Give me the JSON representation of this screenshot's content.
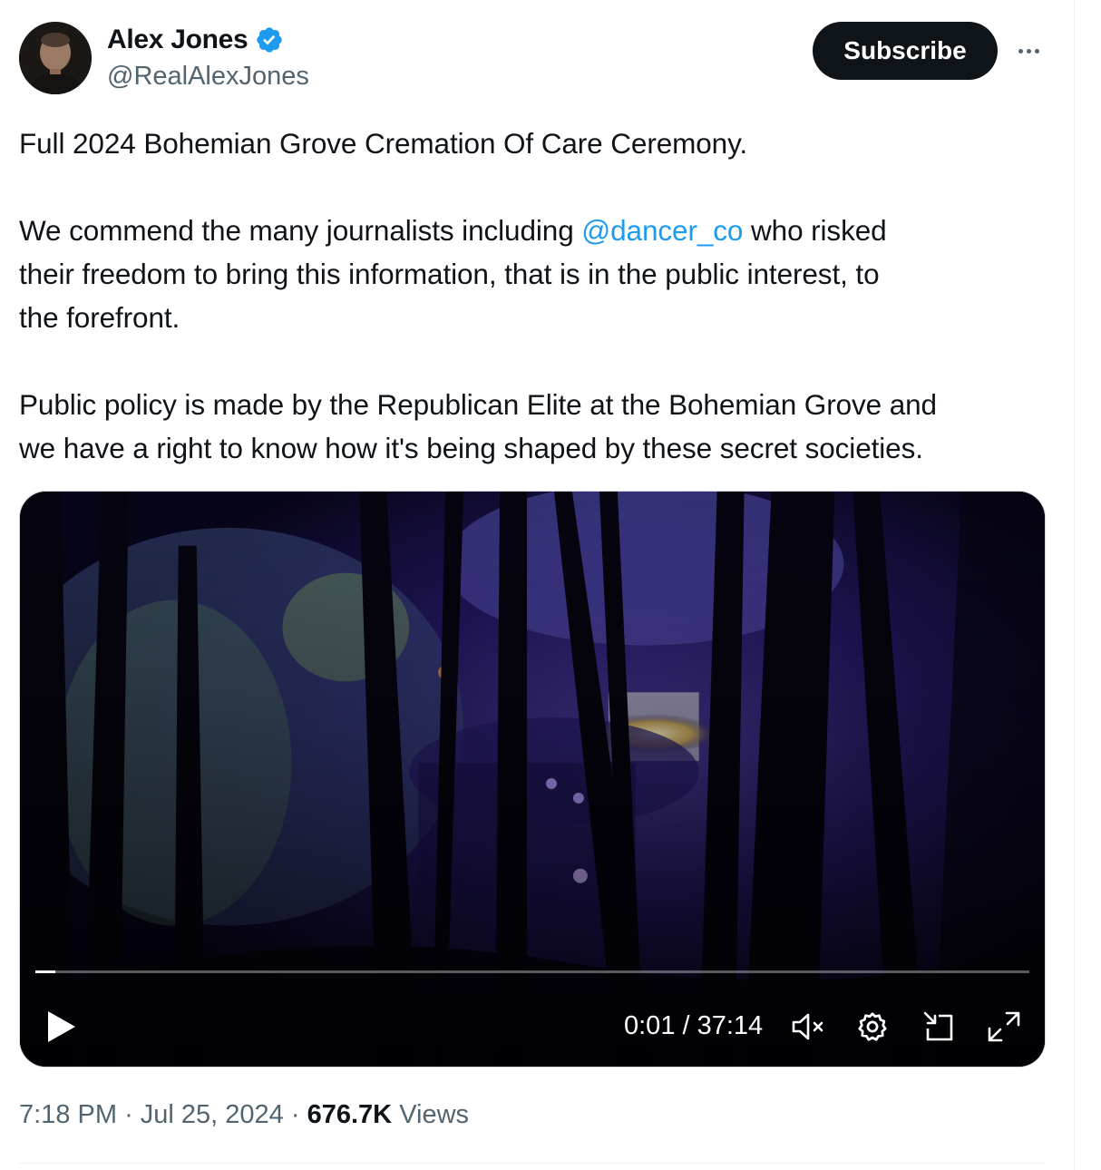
{
  "author": {
    "name": "Alex Jones",
    "handle": "@RealAlexJones",
    "verified": true,
    "verified_color": "#1d9bf0"
  },
  "actions": {
    "subscribe_label": "Subscribe",
    "more_icon": "more-horizontal-icon"
  },
  "tweet": {
    "line1": "Full 2024 Bohemian Grove Cremation Of Care Ceremony.",
    "p2_line1_before": "We commend the many journalists including ",
    "mention": "@dancer_co",
    "p2_line1_after": " who risked",
    "p2_line2": "their freedom to bring this information, that is in the public interest, to",
    "p2_line3": "the forefront.",
    "p3_line1": "Public policy is made by the Republican Elite at the Bohemian Grove and",
    "p3_line2": "we have a right to know how it's being shaped by these secret societies."
  },
  "video": {
    "current_time": "0:01",
    "duration": "37:14",
    "time_display": "0:01 / 37:14",
    "progress_fraction": 0.0005,
    "icons": [
      "play-icon",
      "mute-icon",
      "settings-icon",
      "pip-icon",
      "fullscreen-icon"
    ]
  },
  "meta": {
    "time": "7:18 PM",
    "date": "Jul 25, 2024",
    "separator": "·",
    "views_count": "676.7K",
    "views_label": "Views"
  },
  "colors": {
    "text": "#0f1419",
    "secondary": "#536471",
    "link": "#1d9bf0",
    "button_bg": "#0f1419"
  }
}
